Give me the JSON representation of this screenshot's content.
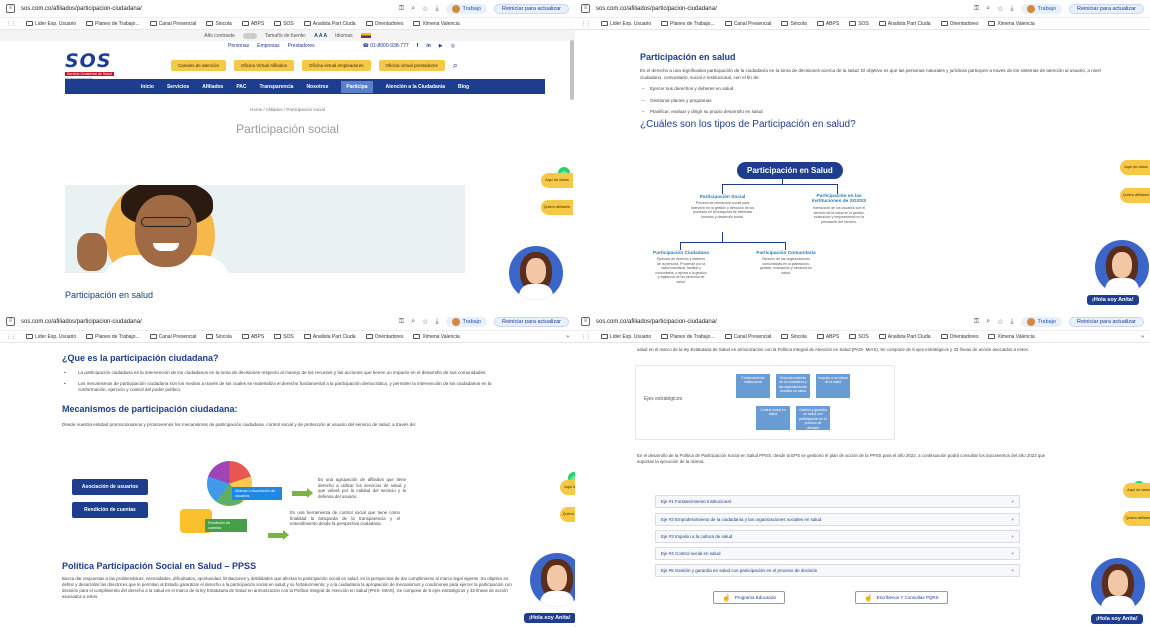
{
  "browser": {
    "url": "sos.com.co/afiliados/participacion-ciudadana/",
    "profile_label": "Trabajo",
    "restart_label": "Reiniciar para actualizar",
    "bookmarks": [
      "Lider Exp. Usuario",
      "Planes de Trabajo...",
      "Canal Presencial",
      "Sincola",
      "ABPS",
      "SOS",
      "Analista Part Ciuda",
      "Orientadores",
      "Ximena Valencia"
    ],
    "more": "»"
  },
  "site": {
    "utility": {
      "contrast": "Alto contraste",
      "font_size": "Tamaño de fuente:",
      "font_letters": "A A A",
      "language": "Idiomas"
    },
    "top_links": [
      "Personas",
      "Empresas",
      "Prestadores"
    ],
    "phone": "01-8000-938-777",
    "logo": {
      "name": "SOS",
      "tagline": "Servicio Occidental de Salud",
      "sub": "EN INTERVENCIÓN"
    },
    "header_buttons": [
      "Canales de atención",
      "Oficina Virtual Afiliados",
      "Oficina virtual empleadores",
      "Oficina virtual prestadores"
    ],
    "nav": [
      "Inicio",
      "Servicios",
      "Afiliados",
      "PAC",
      "Transparencia",
      "Nosotros",
      "Participa",
      "Atención a la Ciudadanía",
      "Blog"
    ],
    "breadcrumb": "Home  /  Afiliados  /  Participación social",
    "page_title": "Participación social",
    "section_participacion": "Participación en salud"
  },
  "widgets": {
    "float_btn_1": "Aquí de datos",
    "float_btn_2": "Quiero afiliarme",
    "hola": "¡Hola soy Anita!",
    "whatsapp": "✆"
  },
  "tr": {
    "title": "Participación en salud",
    "intro": "Es el derecho a una significativa participación de la ciudadanía en la toma de decisiones acerca de la salud. El objetivo es que las personas naturales y jurídicas participen a través de los sistemas de atención al usuario, a nivel ciudadano, comunitario, social e institucional, con el fin de:",
    "bullets": [
      "Ejercer sus derechos y deberes en salud",
      "Gestionar planes y programas",
      "Planificar, evaluar y dirigir su propio desarrollo en salud"
    ],
    "question": "¿Cuáles son los tipos de Participación en salud?",
    "org": {
      "root": "Participación en Salud",
      "social_title": "Participación Social",
      "social_desc": "Proceso de interacción social para intervenir en la gestión y dirección de los procesos en la búsqueda de bienestar humano y desarrollo social.",
      "inst_title": "Participación en las Instituciones de SGSSS",
      "inst_desc": "Interacción de los usuarios con el servicio de la salud en la gestión evaluación y mejoramiento en la prestación del servicio.",
      "ciud_title": "Participación Ciudadana",
      "ciud_desc": "Ejercicio de derecho y deberes de la persona. Propende por la salud individual, familiar y comunitaria, y aporta a la gestión y vigilancia de los servicios de salud.",
      "com_title": "Participación Comunitaria",
      "com_desc": "Derecho de las organizaciones comunitarias en la planeación, gestión, evaluación y veeduría en salud."
    }
  },
  "bl": {
    "q_title": "¿Que es la participación ciudadana?",
    "q_bullets": [
      "La participación ciudadana es la intervención de los ciudadanos en la toma de decisiones respecto al manejo de los recursos y las acciones que tienen un impacto en el desarrollo de sus comunidades.",
      "Los mecanismos de participación ciudadana son los medios a través de los cuales se materializa el derecho fundamental a la participación democrática, y permiten la intervención de los ciudadanos en la conformación, ejercicio y control del poder político."
    ],
    "mech_title": "Mecanismos de participación ciudadana:",
    "mech_intro": "Desde nuestra entidad promocionamos y promovemos los mecanismos de participación ciudadana, control social y de protección al usuario del servicio de salud, a través de:",
    "btn_asociacion": "Asociación de usuarios",
    "btn_rendicion": "Rendición de cuentas",
    "asoc_badge": "Alianza o Asociación de usuarios",
    "rend_badge": "Rendición de cuentas",
    "asoc_desc": "Es una agrupación de afiliados que tiene derecho a utilizar los servicios de salud y que velará por la calidad del servicio y la defensa del usuario.",
    "rend_desc": "Es una herramienta de control social que tiene como finalidad la búsqueda de la transparencia y el entendimiento desde la perspectiva ciudadana.",
    "pol_title": "Política Participación Social en Salud – PPSS",
    "pol_text": "Busca dar respuestas a las problemáticas, necesidades, dificultades, oportunidad, limitaciones y debilidades que afectan la participación social en salud, en la perspectiva de dar cumplimiento al marco legal vigente. Su objetivo es definir y desarrollar las directrices que le permitan al Estado garantizar el derecho a la participación social en salud y su fortalecimiento; y a la ciudadanía la apropiación de mecanismos y condiciones para ejercer la participación con decisión para el cumplimiento del derecho a la salud en el marco de la ley Estatutaria de Salud en armonización con la Política Integral de Atención en Salud (PAIS- MIAS). Se compone de 5 ejes estratégicos y 33 líneas de acción asociados a estos."
  },
  "br": {
    "top_text": "salud en el marco de la ley Estatutaria de Salud en armonización con la Política Integral de Atención en Salud (PAIS- MIAS). Se compone de 5 ejes estratégicos y 33 líneas de acción asociados a estos.",
    "ejes_label": "Ejes estratégicos",
    "ejes_boxes": [
      "Fortalecimiento institucional",
      "Empoderamiento de la ciudadanía y las organizaciones sociales en salud",
      "Impulso a la cultura de la salud",
      "Control social en salud",
      "Gestión y garantía en salud con participación en el proceso de decisión"
    ],
    "plan_text": "En el desarrollo de la Política de Participación Social en Salud PPSS, desde la EPS se gestionó el plan de acción de la PPSS para el año 2022, a continuación podrá consultar los documentos del año 2023 que soportan la ejecución de la misma.",
    "accordion": [
      "Eje #1 Fortalecimiento Institucional",
      "Eje #2 Empoderamiento de la ciudadanía y las organizaciones sociales en salud",
      "Eje #3 Impulso a la cultura de salud",
      "Eje #4 Control social en salud",
      "Eje #5 Gestión y garantía en salud con participación en el proceso de decisión"
    ],
    "btn_programa": "Programa Educando",
    "btn_pqrs": "Escríbenos Y Consultas PQRS"
  }
}
